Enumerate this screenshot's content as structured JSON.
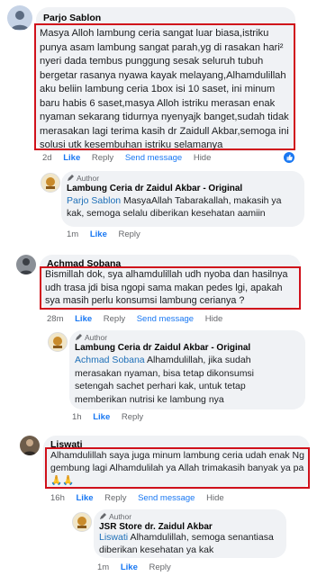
{
  "comments": [
    {
      "name": "Parjo Sablon",
      "text": "Masya Alloh lambung ceria sangat luar biasa,istriku punya asam lambung sangat parah,yg di rasakan hari² nyeri dada tembus punggung sesak seluruh tubuh bergetar rasanya nyawa kayak melayang,Alhamdulillah aku beliin lambung ceria 1box isi 10 saset, ini minum baru habis 6 saset,masya Alloh istriku merasan enak nyaman sekarang tidurnya nyenyajk banget,sudah tidak merasakan lagi terima kasih dr Zaidull Akbar,semoga ini solusi utk kesembuhan istriku selamanya",
      "time": "2d",
      "like": "Like",
      "reply": "Reply",
      "send": "Send message",
      "hide": "Hide",
      "sub": {
        "author_label": "Author",
        "name": "Lambung Ceria dr Zaidul Akbar - Original",
        "mention": "Parjo Sablon",
        "text": " MasyaAllah Tabarakallah, makasih ya kak, semoga selalu diberikan kesehatan aamiin",
        "time": "1m",
        "like": "Like",
        "reply": "Reply"
      }
    },
    {
      "name": "Achmad Sobana",
      "text": "Bismillah dok, sya alhamdulillah udh nyoba dan hasilnya udh trasa jdi bisa ngopi sama makan pedes lgi, apakah sya masih perlu konsumsi lambung cerianya ?",
      "time": "28m",
      "like": "Like",
      "reply": "Reply",
      "send": "Send message",
      "hide": "Hide",
      "sub": {
        "author_label": "Author",
        "name": "Lambung Ceria dr Zaidul Akbar - Original",
        "mention": "Achmad Sobana",
        "text": " Alhamdulillah, jika sudah merasakan nyaman, bisa tetap dikonsumsi setengah sachet perhari kak, untuk tetap memberikan nutrisi ke lambung nya",
        "time": "1h",
        "like": "Like",
        "reply": "Reply"
      }
    },
    {
      "name": "Liswati",
      "text": "Alhamdulillah saya juga minum lambung ceria udah enak Ng gembung lagi Alhamdulilah ya Allah trimakasih banyak ya pa 🙏🙏",
      "time": "16h",
      "like": "Like",
      "reply": "Reply",
      "send": "Send message",
      "hide": "Hide",
      "sub": {
        "author_label": "Author",
        "name": "JSR Store dr. Zaidul Akbar",
        "mention": "Liswati",
        "text": " Alhamdulillah, semoga senantiasa diberikan kesehatan ya kak",
        "time": "1m",
        "like": "Like",
        "reply": "Reply"
      }
    }
  ],
  "colors": {
    "highlight": "#d0111b",
    "link": "#1877f2",
    "mention": "#1d6fb8"
  },
  "icons": [
    "person-icon",
    "like-reaction-icon",
    "author-pen-icon"
  ]
}
